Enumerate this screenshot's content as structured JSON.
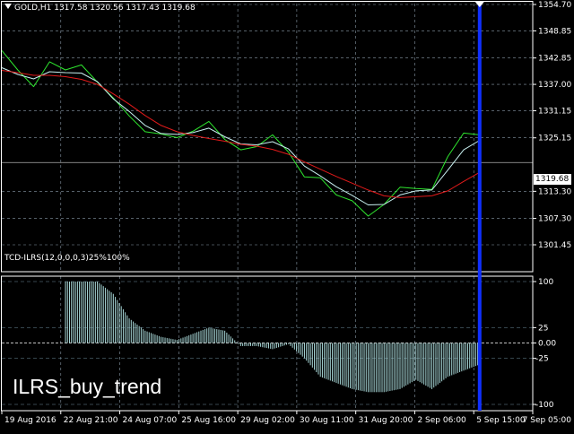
{
  "chart_data": [
    {
      "type": "line",
      "title": "GOLD,H1  1317.58 1320.56 1317.43 1319.68",
      "symbol": "GOLD",
      "timeframe": "H1",
      "ohlc": {
        "open": 1317.58,
        "high": 1320.56,
        "low": 1317.43,
        "close": 1319.68
      },
      "current_price_label": "1319.68",
      "y_tick_labels": [
        "1354.70",
        "1348.85",
        "1342.85",
        "1337.00",
        "1331.15",
        "1325.15",
        "1313.30",
        "1307.30",
        "1301.45"
      ],
      "ylim": [
        1301.45,
        1354.7
      ],
      "x_tick_labels": [
        "19 Aug 2016",
        "22 Aug 21:00",
        "24 Aug 07:00",
        "25 Aug 16:00",
        "29 Aug 02:00",
        "30 Aug 11:00",
        "31 Aug 20:00",
        "2 Sep 06:00",
        "5 Sep 15:00",
        "7 Sep 05:00"
      ],
      "grid": true,
      "colors": {
        "background": "#000000",
        "grid": "#8a9aa8",
        "price_line": "#2ee62e",
        "fast_line": "#c8f0f0",
        "slow_line": "#e21a1a",
        "vertical_marker": "#1030ff",
        "text": "#ffffff"
      },
      "x": [
        0,
        3,
        6,
        9,
        12,
        15,
        18,
        21,
        24,
        27,
        30,
        33,
        36,
        39,
        42,
        45,
        48,
        51,
        54,
        57,
        60,
        63,
        66,
        69,
        72,
        75,
        78,
        81,
        84,
        87,
        90
      ],
      "series": [
        {
          "values": [
            1344.5,
            1340.2,
            1336.5,
            1342.0,
            1340.2,
            1341.3,
            1337.5,
            1334.0,
            1330.0,
            1326.5,
            1326.0,
            1325.2,
            1326.6,
            1328.8,
            1324.8,
            1322.5,
            1323.2,
            1325.8,
            1322.0,
            1316.5,
            1316.3,
            1312.5,
            1311.2,
            1307.8,
            1310.4,
            1314.2,
            1313.9,
            1313.7,
            1321.0,
            1326.2,
            1325.8
          ]
        },
        {
          "values": [
            1340.7,
            1339.2,
            1338.2,
            1339.8,
            1339.6,
            1339.5,
            1337.6,
            1333.8,
            1331.0,
            1327.9,
            1326.1,
            1325.9,
            1326.3,
            1327.3,
            1325.4,
            1323.8,
            1323.6,
            1324.3,
            1322.7,
            1318.9,
            1316.7,
            1314.3,
            1312.4,
            1310.3,
            1310.4,
            1312.5,
            1313.4,
            1313.6,
            1318.0,
            1322.5,
            1324.6
          ]
        },
        {
          "values": [
            1340.1,
            1339.6,
            1339.0,
            1339.0,
            1338.7,
            1338.1,
            1337.0,
            1334.9,
            1332.6,
            1330.1,
            1327.9,
            1326.5,
            1325.7,
            1325.0,
            1324.4,
            1323.7,
            1323.3,
            1322.6,
            1321.5,
            1319.8,
            1318.2,
            1316.6,
            1315.1,
            1313.6,
            1312.3,
            1311.9,
            1312.1,
            1312.3,
            1313.4,
            1315.5,
            1317.5
          ]
        }
      ]
    },
    {
      "type": "bar",
      "title": "TCD-ILRS(12,0,0,0,3)25%100%",
      "y_tick_labels": [
        "100",
        "25",
        "0.00",
        "-25",
        "-100"
      ],
      "ylim": [
        -100,
        100
      ],
      "categories": [
        "19 Aug 2016",
        "22 Aug 21:00",
        "24 Aug 07:00",
        "25 Aug 16:00",
        "29 Aug 02:00",
        "30 Aug 11:00",
        "31 Aug 20:00",
        "2 Sep 06:00",
        "5 Sep 15:00",
        "7 Sep 05:00"
      ],
      "colors": {
        "bars": "#a8d8d8",
        "level_line": "#6e8c9c"
      },
      "x": [
        0,
        3,
        6,
        9,
        12,
        15,
        18,
        21,
        24,
        27,
        30,
        33,
        36,
        39,
        42,
        45,
        48,
        51,
        54,
        57,
        60,
        63,
        66,
        69,
        72,
        75,
        78,
        81,
        84,
        87,
        90
      ],
      "values": [
        null,
        null,
        null,
        null,
        100,
        100,
        100,
        80,
        40,
        20,
        10,
        5,
        15,
        25,
        20,
        -5,
        -5,
        -10,
        -2,
        -25,
        -55,
        -65,
        -75,
        -80,
        -80,
        -75,
        -60,
        -75,
        -55,
        -45,
        -35
      ]
    }
  ],
  "annotation": "ILRS_buy_trend"
}
